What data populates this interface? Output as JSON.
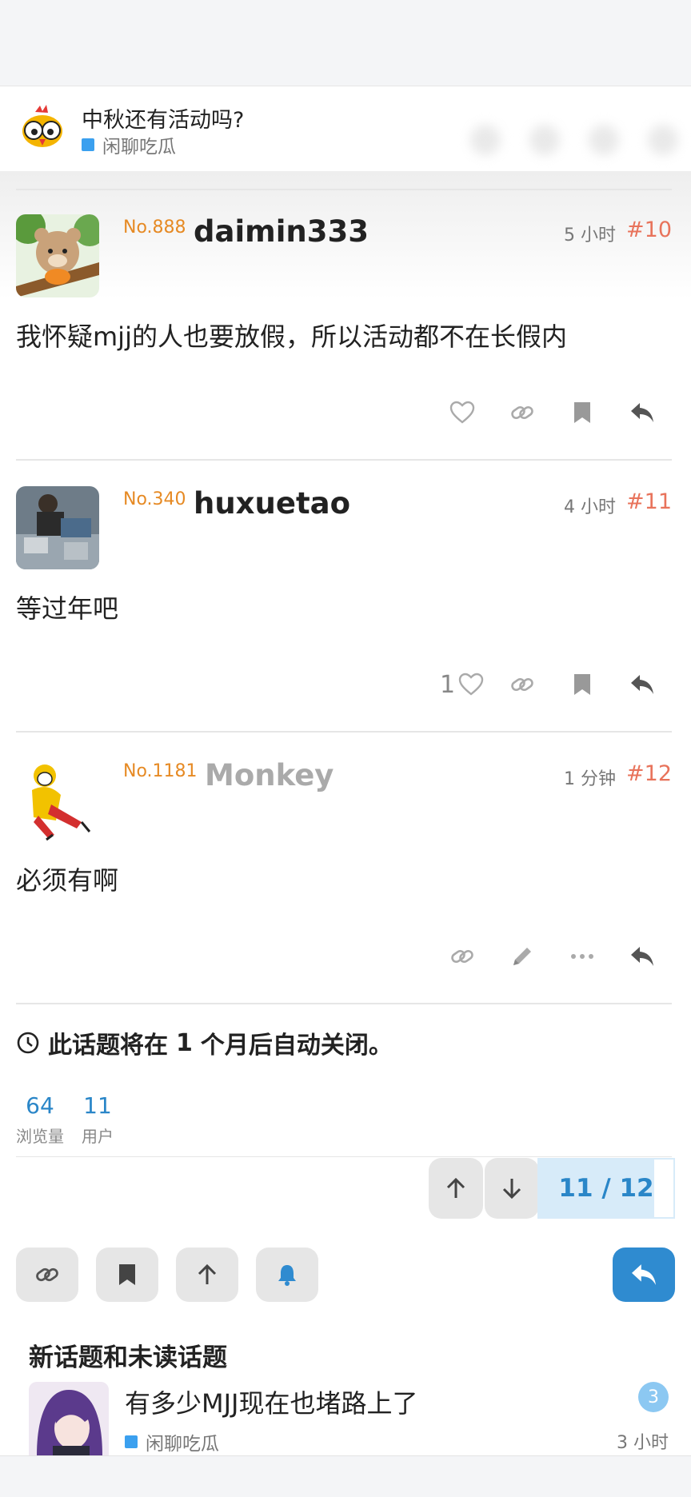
{
  "topic": {
    "title": "中秋还有活动吗?",
    "category": "闲聊吃瓜",
    "category_color": "#3ba0ef"
  },
  "posts": [
    {
      "no": "No.888",
      "username": "daimin333",
      "time": "5 小时",
      "post_number": "#10",
      "body": "我怀疑mjj的人也要放假，所以活动都不在长假内",
      "likes": "",
      "avatar": "bear-in-tree-avatar"
    },
    {
      "no": "No.340",
      "username": "huxuetao",
      "time": "4 小时",
      "post_number": "#11",
      "body": "等过年吧",
      "likes": "1",
      "avatar": "photo-avatar"
    },
    {
      "no": "No.1181",
      "username": "Monkey",
      "time": "1 分钟",
      "post_number": "#12",
      "body": "必须有啊",
      "likes": "",
      "avatar": "monkey-king-avatar"
    }
  ],
  "auto_close": {
    "prefix": "此话题将在",
    "number": "1",
    "suffix": "个月后自动关闭。"
  },
  "stats": [
    {
      "value": "64",
      "label": "浏览量"
    },
    {
      "value": "11",
      "label": "用户"
    }
  ],
  "progress": {
    "text": "11 / 12",
    "current": 11,
    "total": 12
  },
  "suggested": {
    "title": "新话题和未读话题",
    "items": [
      {
        "title": "有多少MJJ现在也堵路上了",
        "category": "闲聊吃瓜",
        "unread": "3",
        "time": "3 小时"
      }
    ]
  },
  "icons": [
    "heart-icon",
    "link-icon",
    "bookmark-icon",
    "reply-icon",
    "pencil-icon",
    "more-icon",
    "clock-icon",
    "arrow-up-icon",
    "arrow-down-icon",
    "bell-icon"
  ],
  "colors": {
    "accent": "#2f8bd0",
    "post_number": "#e8735b",
    "user_level": "#e68a24"
  }
}
